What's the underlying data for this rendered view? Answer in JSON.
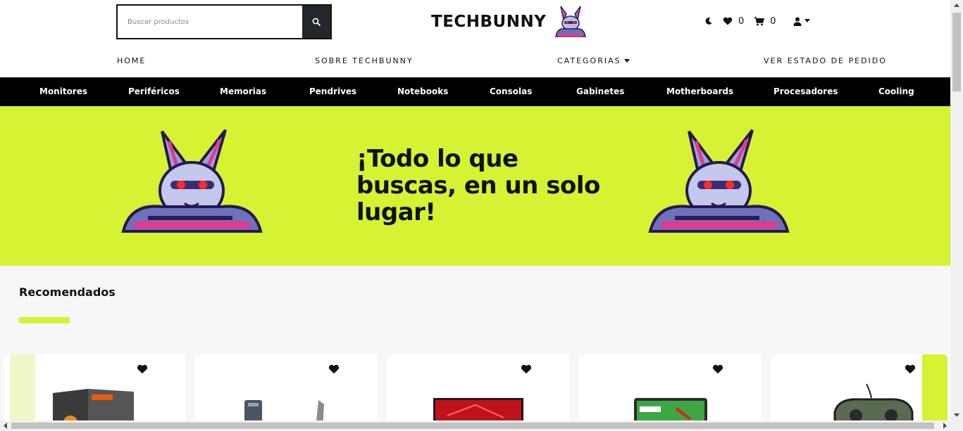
{
  "header": {
    "search_placeholder": "Buscar productos",
    "brand": "TECHBUNNY",
    "wishlist_count": "0",
    "cart_count": "0"
  },
  "mainnav": {
    "home": "HOME",
    "about": "SOBRE TECHBUNNY",
    "categories": "CATEGORIAS",
    "order_status": "VER ESTADO DE PEDIDO"
  },
  "categories": [
    "Monitores",
    "Periféricos",
    "Memorias",
    "Pendrives",
    "Notebooks",
    "Consolas",
    "Gabinetes",
    "Motherboards",
    "Procesadores",
    "Cooling"
  ],
  "hero": {
    "title": "¡Todo lo que buscas, en un solo lugar!"
  },
  "recommended": {
    "title": "Recomendados"
  },
  "colors": {
    "accent": "#d6f233",
    "dark": "#000000",
    "search_button": "#23272b"
  },
  "icons": [
    "search-icon",
    "moon-icon",
    "heart-icon",
    "cart-icon",
    "user-icon",
    "caret-down-icon",
    "bunny-logo"
  ]
}
